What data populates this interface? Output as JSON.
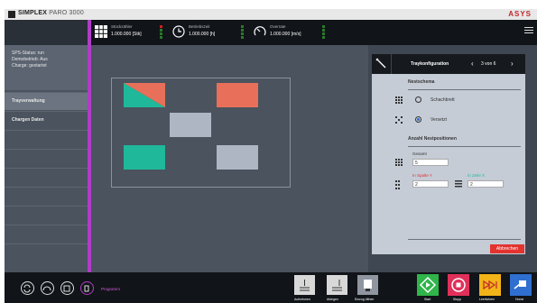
{
  "app": {
    "title_bold": "SIMPLEX",
    "title_light": "PARO 3000",
    "brand": "ASYS"
  },
  "header": {
    "stats": [
      {
        "label": "Stückzähler",
        "value": "1.000.000 [Stk]"
      },
      {
        "label": "Betriebszeit",
        "value": "1.000.000 [h]"
      },
      {
        "label": "Overrate",
        "value": "1.000.000 [m/s]"
      }
    ]
  },
  "sidebar": {
    "status_lines": [
      "SPS-Status: run",
      "Demobetrieb: Aus",
      "Charge: gestartet"
    ],
    "items": [
      {
        "label": "Trayverwaltung"
      },
      {
        "label": "Chargen Daten"
      }
    ]
  },
  "tray": {
    "nests": [
      {
        "name": "nest-diagonal",
        "color_a": "#e8705a",
        "color_b": "#1fb89a"
      },
      {
        "name": "nest-top-right",
        "color": "#e8705a"
      },
      {
        "name": "nest-center",
        "color": "#aeb6c4"
      },
      {
        "name": "nest-bottom-left",
        "color": "#1fb89a"
      },
      {
        "name": "nest-bottom-right",
        "color": "#aeb6c4"
      }
    ]
  },
  "panel": {
    "title": "Traykonfiguration",
    "page": "3 von 6",
    "nest_scheme_title": "Nestschema",
    "options": [
      {
        "label": "Schachbrett",
        "selected": false
      },
      {
        "label": "Versetzt",
        "selected": true
      }
    ],
    "positions_title": "Anzahl Nestpositionen",
    "total_label": "Gesamt",
    "total_value": "5",
    "columns_label": "In Spalte Y",
    "columns_value": "2",
    "rows_label": "In Zeile X",
    "rows_value": "2",
    "cancel_label": "Abbrechen"
  },
  "bottom": {
    "programs_label": "Programm",
    "actions": [
      {
        "label": "Aufnehmen"
      },
      {
        "label": "Ablegen"
      },
      {
        "label": "Einzug öffnen"
      }
    ],
    "controls": [
      {
        "label": "Start",
        "color": "#2fb54a"
      },
      {
        "label": "Stopp",
        "color": "#e0305a"
      },
      {
        "label": "Leerfahren",
        "color": "#f2b418"
      },
      {
        "label": "Home",
        "color": "#2f6fd0"
      }
    ]
  },
  "colors": {
    "accent": "#b03cc7",
    "panel": "#c5ccd6",
    "danger": "#e3332f"
  }
}
